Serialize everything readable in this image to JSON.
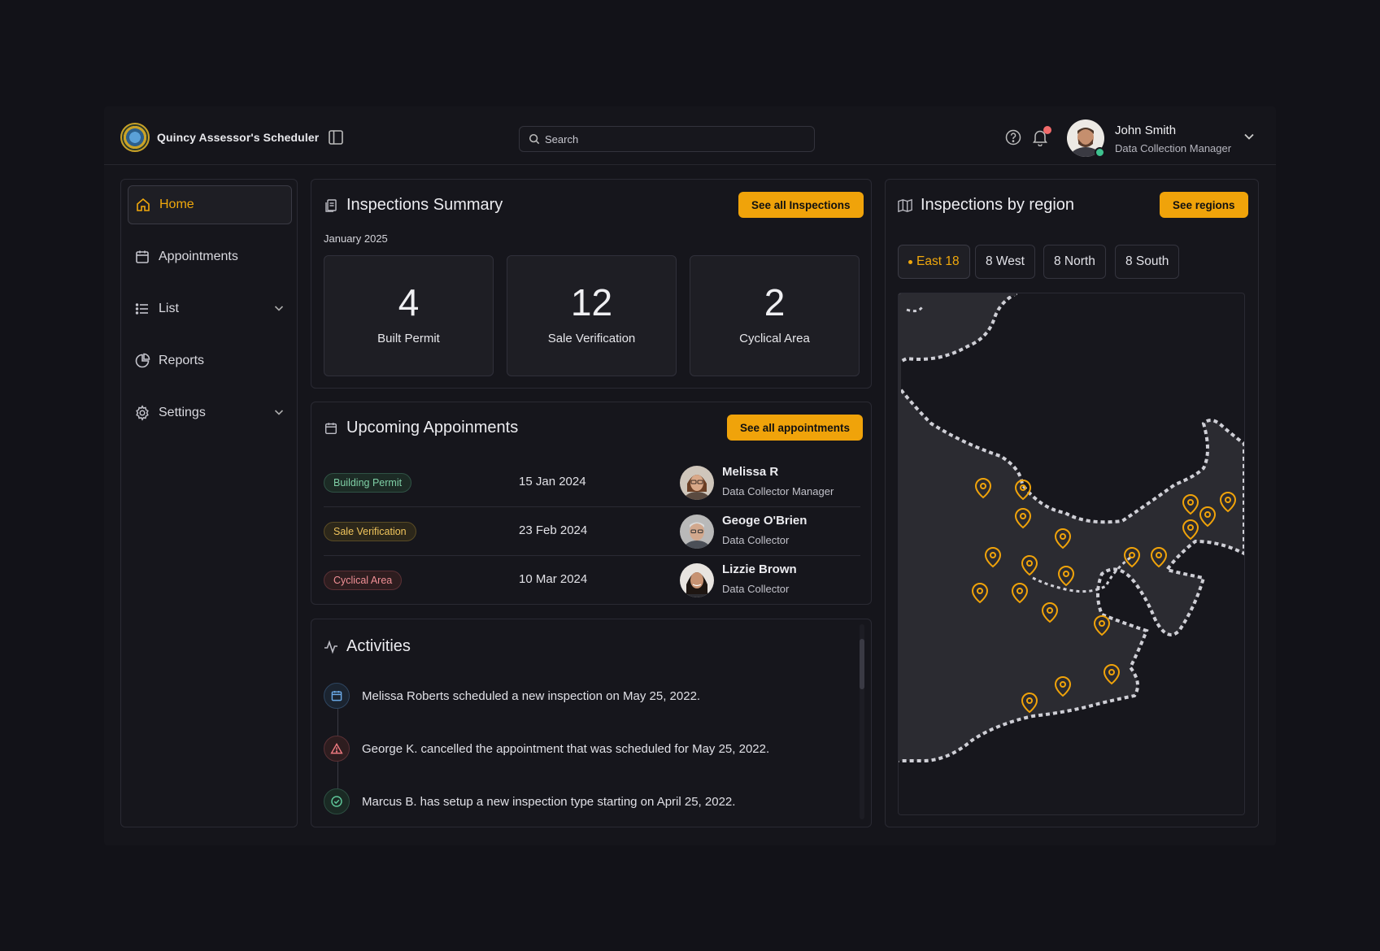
{
  "app": {
    "name": "Quincy Assessor's Scheduler"
  },
  "search": {
    "placeholder": "Search"
  },
  "user": {
    "name": "John Smith",
    "role": "Data Collection Manager"
  },
  "nav": {
    "home": "Home",
    "appointments": "Appointments",
    "list": "List",
    "reports": "Reports",
    "settings": "Settings"
  },
  "summary": {
    "title": "Inspections Summary",
    "button": "See all Inspections",
    "month": "January 2025",
    "stats": [
      {
        "value": "4",
        "label": "Built Permit"
      },
      {
        "value": "12",
        "label": "Sale Verification"
      },
      {
        "value": "2",
        "label": "Cyclical Area"
      }
    ]
  },
  "appointments": {
    "title": "Upcoming Appoinments",
    "button": "See all appointments",
    "rows": [
      {
        "type": "Building Permit",
        "date": "15 Jan 2024",
        "name": "Melissa R",
        "role": "Data Collector Manager"
      },
      {
        "type": "Sale Verification",
        "date": "23 Feb 2024",
        "name": "Geoge O'Brien",
        "role": "Data Collector"
      },
      {
        "type": "Cyclical Area",
        "date": "10 Mar 2024",
        "name": "Lizzie Brown",
        "role": "Data Collector"
      }
    ]
  },
  "activities": {
    "title": "Activities",
    "items": [
      {
        "text": "Melissa Roberts scheduled a new inspection on May 25, 2022."
      },
      {
        "text": "George K. cancelled the appointment that was scheduled for May 25, 2022."
      },
      {
        "text": "Marcus B. has setup a new inspection type starting on April 25, 2022."
      }
    ]
  },
  "region": {
    "title": "Inspections by region",
    "button": "See regions",
    "tabs": [
      "East 18",
      "8 West",
      "8 North",
      "8 South"
    ]
  },
  "colors": {
    "accent": "#f0a30a",
    "background": "#121218",
    "panel": "#16161c"
  },
  "icons": {
    "nav": [
      "home-icon",
      "calendar-icon",
      "list-icon",
      "pie-chart-icon",
      "gear-icon"
    ],
    "header": [
      "sidebar-toggle-icon",
      "search-icon",
      "help-icon",
      "bell-icon",
      "chevron-down-icon"
    ],
    "activities": [
      "calendar-icon",
      "warning-icon",
      "check-circle-icon"
    ],
    "map": "map-pin-icon"
  }
}
